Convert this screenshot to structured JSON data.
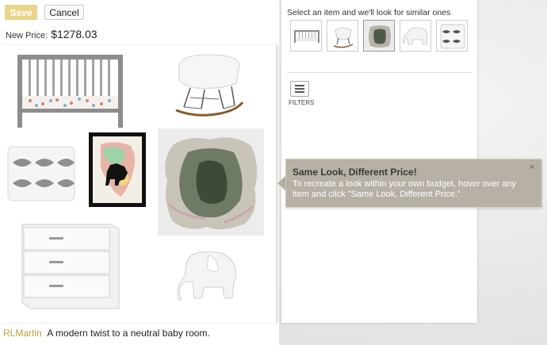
{
  "toolbar": {
    "save_label": "Save",
    "cancel_label": "Cancel"
  },
  "price": {
    "label": "New Price:",
    "value": "$1278.03"
  },
  "caption": {
    "user": "RLMartin",
    "text": "A modern twist to a neutral baby room."
  },
  "panel": {
    "heading": "Select an item and we'll look for similar ones",
    "thumbs": [
      "crib",
      "rocking-chair",
      "rug",
      "elephant",
      "pillow"
    ],
    "filters_label": "FILTERS"
  },
  "tooltip": {
    "title": "Same Look, Different Price!",
    "body": "To recreate a look within your own budget, hover over any item and click \"Same Look, Different Price.\"",
    "close": "×"
  },
  "colors": {
    "accent": "#e8d48a",
    "username": "#b9a33c",
    "tooltip_bg": "#b6b0a5"
  },
  "icons": [
    "filters-icon",
    "close-icon"
  ]
}
